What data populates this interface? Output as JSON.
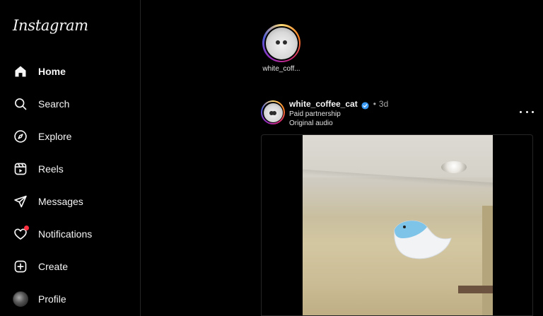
{
  "app": {
    "logo": "Instagram"
  },
  "sidebar": {
    "items": [
      {
        "label": "Home",
        "icon": "home-icon",
        "active": true
      },
      {
        "label": "Search",
        "icon": "search-icon"
      },
      {
        "label": "Explore",
        "icon": "compass-icon"
      },
      {
        "label": "Reels",
        "icon": "reels-icon"
      },
      {
        "label": "Messages",
        "icon": "paper-plane-icon"
      },
      {
        "label": "Notifications",
        "icon": "heart-icon",
        "badge_color": "#ff3040"
      },
      {
        "label": "Create",
        "icon": "plus-square-icon"
      },
      {
        "label": "Profile",
        "icon": "avatar"
      }
    ]
  },
  "stories": [
    {
      "username": "white_coff..."
    }
  ],
  "post": {
    "username": "white_coffee_cat",
    "verified": true,
    "time": "3d",
    "separator": "•",
    "label_partnership": "Paid partnership",
    "audio": "Original audio"
  },
  "colors": {
    "background": "#000000",
    "verified_blue": "#3897f0",
    "notification_dot": "#ff3040"
  }
}
